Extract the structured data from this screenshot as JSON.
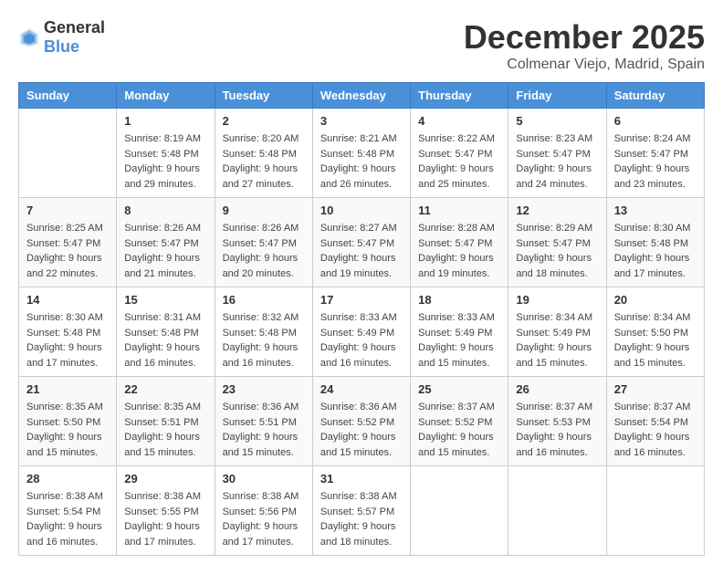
{
  "header": {
    "logo_general": "General",
    "logo_blue": "Blue",
    "month": "December 2025",
    "location": "Colmenar Viejo, Madrid, Spain"
  },
  "days_of_week": [
    "Sunday",
    "Monday",
    "Tuesday",
    "Wednesday",
    "Thursday",
    "Friday",
    "Saturday"
  ],
  "weeks": [
    [
      {
        "day": "",
        "info": ""
      },
      {
        "day": "1",
        "info": "Sunrise: 8:19 AM\nSunset: 5:48 PM\nDaylight: 9 hours\nand 29 minutes."
      },
      {
        "day": "2",
        "info": "Sunrise: 8:20 AM\nSunset: 5:48 PM\nDaylight: 9 hours\nand 27 minutes."
      },
      {
        "day": "3",
        "info": "Sunrise: 8:21 AM\nSunset: 5:48 PM\nDaylight: 9 hours\nand 26 minutes."
      },
      {
        "day": "4",
        "info": "Sunrise: 8:22 AM\nSunset: 5:47 PM\nDaylight: 9 hours\nand 25 minutes."
      },
      {
        "day": "5",
        "info": "Sunrise: 8:23 AM\nSunset: 5:47 PM\nDaylight: 9 hours\nand 24 minutes."
      },
      {
        "day": "6",
        "info": "Sunrise: 8:24 AM\nSunset: 5:47 PM\nDaylight: 9 hours\nand 23 minutes."
      }
    ],
    [
      {
        "day": "7",
        "info": "Sunrise: 8:25 AM\nSunset: 5:47 PM\nDaylight: 9 hours\nand 22 minutes."
      },
      {
        "day": "8",
        "info": "Sunrise: 8:26 AM\nSunset: 5:47 PM\nDaylight: 9 hours\nand 21 minutes."
      },
      {
        "day": "9",
        "info": "Sunrise: 8:26 AM\nSunset: 5:47 PM\nDaylight: 9 hours\nand 20 minutes."
      },
      {
        "day": "10",
        "info": "Sunrise: 8:27 AM\nSunset: 5:47 PM\nDaylight: 9 hours\nand 19 minutes."
      },
      {
        "day": "11",
        "info": "Sunrise: 8:28 AM\nSunset: 5:47 PM\nDaylight: 9 hours\nand 19 minutes."
      },
      {
        "day": "12",
        "info": "Sunrise: 8:29 AM\nSunset: 5:47 PM\nDaylight: 9 hours\nand 18 minutes."
      },
      {
        "day": "13",
        "info": "Sunrise: 8:30 AM\nSunset: 5:48 PM\nDaylight: 9 hours\nand 17 minutes."
      }
    ],
    [
      {
        "day": "14",
        "info": "Sunrise: 8:30 AM\nSunset: 5:48 PM\nDaylight: 9 hours\nand 17 minutes."
      },
      {
        "day": "15",
        "info": "Sunrise: 8:31 AM\nSunset: 5:48 PM\nDaylight: 9 hours\nand 16 minutes."
      },
      {
        "day": "16",
        "info": "Sunrise: 8:32 AM\nSunset: 5:48 PM\nDaylight: 9 hours\nand 16 minutes."
      },
      {
        "day": "17",
        "info": "Sunrise: 8:33 AM\nSunset: 5:49 PM\nDaylight: 9 hours\nand 16 minutes."
      },
      {
        "day": "18",
        "info": "Sunrise: 8:33 AM\nSunset: 5:49 PM\nDaylight: 9 hours\nand 15 minutes."
      },
      {
        "day": "19",
        "info": "Sunrise: 8:34 AM\nSunset: 5:49 PM\nDaylight: 9 hours\nand 15 minutes."
      },
      {
        "day": "20",
        "info": "Sunrise: 8:34 AM\nSunset: 5:50 PM\nDaylight: 9 hours\nand 15 minutes."
      }
    ],
    [
      {
        "day": "21",
        "info": "Sunrise: 8:35 AM\nSunset: 5:50 PM\nDaylight: 9 hours\nand 15 minutes."
      },
      {
        "day": "22",
        "info": "Sunrise: 8:35 AM\nSunset: 5:51 PM\nDaylight: 9 hours\nand 15 minutes."
      },
      {
        "day": "23",
        "info": "Sunrise: 8:36 AM\nSunset: 5:51 PM\nDaylight: 9 hours\nand 15 minutes."
      },
      {
        "day": "24",
        "info": "Sunrise: 8:36 AM\nSunset: 5:52 PM\nDaylight: 9 hours\nand 15 minutes."
      },
      {
        "day": "25",
        "info": "Sunrise: 8:37 AM\nSunset: 5:52 PM\nDaylight: 9 hours\nand 15 minutes."
      },
      {
        "day": "26",
        "info": "Sunrise: 8:37 AM\nSunset: 5:53 PM\nDaylight: 9 hours\nand 16 minutes."
      },
      {
        "day": "27",
        "info": "Sunrise: 8:37 AM\nSunset: 5:54 PM\nDaylight: 9 hours\nand 16 minutes."
      }
    ],
    [
      {
        "day": "28",
        "info": "Sunrise: 8:38 AM\nSunset: 5:54 PM\nDaylight: 9 hours\nand 16 minutes."
      },
      {
        "day": "29",
        "info": "Sunrise: 8:38 AM\nSunset: 5:55 PM\nDaylight: 9 hours\nand 17 minutes."
      },
      {
        "day": "30",
        "info": "Sunrise: 8:38 AM\nSunset: 5:56 PM\nDaylight: 9 hours\nand 17 minutes."
      },
      {
        "day": "31",
        "info": "Sunrise: 8:38 AM\nSunset: 5:57 PM\nDaylight: 9 hours\nand 18 minutes."
      },
      {
        "day": "",
        "info": ""
      },
      {
        "day": "",
        "info": ""
      },
      {
        "day": "",
        "info": ""
      }
    ]
  ]
}
